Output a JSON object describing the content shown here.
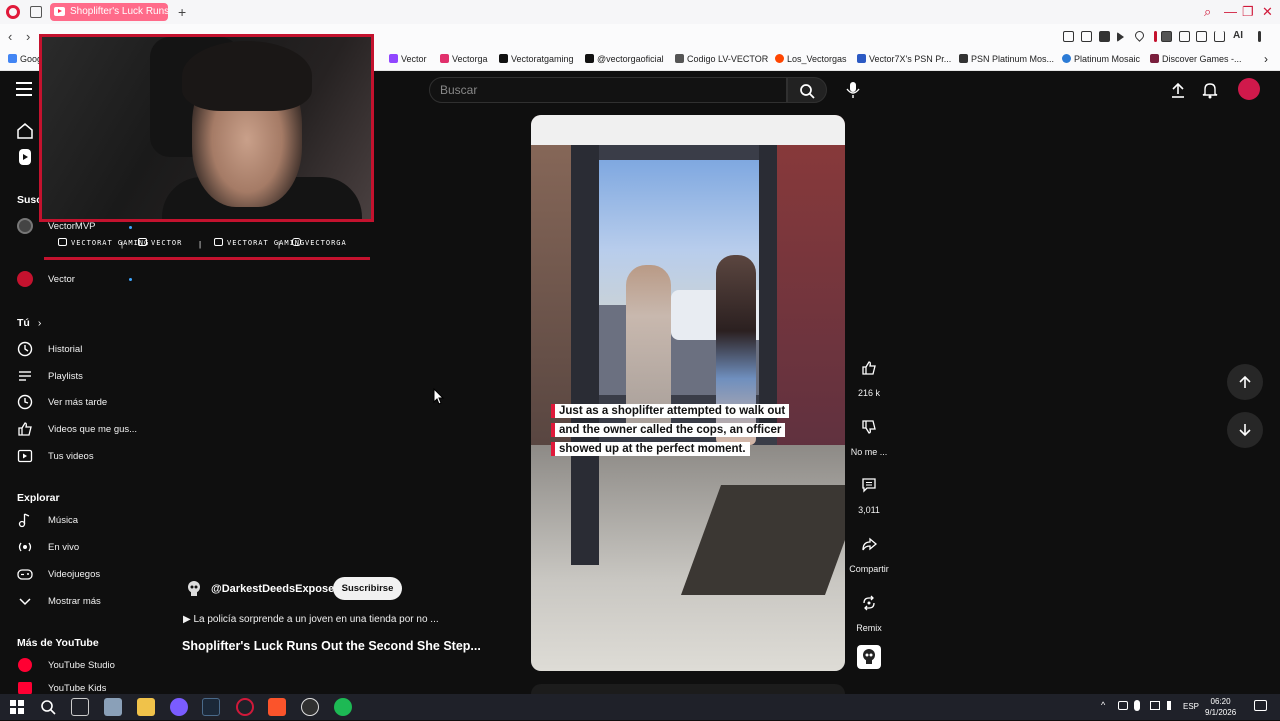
{
  "browser": {
    "active_tab_title": "Shoplifter's Luck Runs",
    "new_tab_symbol": "+",
    "back_symbol": "‹",
    "forward_symbol": "›",
    "bookmarks": [
      {
        "label": "Goog",
        "color": "#4285f4"
      },
      {
        "label": "Vector",
        "color": "#9146ff"
      },
      {
        "label": "Vectorga",
        "color": "#e1306c"
      },
      {
        "label": "Vectoratgaming",
        "color": "#111111"
      },
      {
        "label": "@vectorgaoficial",
        "color": "#111111"
      },
      {
        "label": "Codigo LV-VECTOR",
        "color": "#555555"
      },
      {
        "label": "Los_Vectorgas",
        "color": "#ff4500"
      },
      {
        "label": "Vector7X's PSN Pr...",
        "color": "#2b59c3"
      },
      {
        "label": "PSN Platinum Mos...",
        "color": "#333333"
      },
      {
        "label": "Platinum Mosaic",
        "color": "#2b7bd6"
      },
      {
        "label": "Discover Games -...",
        "color": "#7a1f3d"
      }
    ],
    "bookmarks_overflow": "›",
    "ext_label": "AI"
  },
  "header": {
    "search_placeholder": "Buscar"
  },
  "sidebar": {
    "subscriptions_title": "Susc",
    "subscriptions": [
      {
        "label": "VectorMVP",
        "color": "#444444"
      },
      {
        "label": "Vector",
        "color": "#c4122e"
      }
    ],
    "you_title": "Tú",
    "you_items": [
      {
        "label": "Historial",
        "icon": "history-icon"
      },
      {
        "label": "Playlists",
        "icon": "playlist-icon"
      },
      {
        "label": "Ver más tarde",
        "icon": "clock-icon"
      },
      {
        "label": "Videos que me gus...",
        "icon": "thumb-up-icon"
      },
      {
        "label": "Tus videos",
        "icon": "video-icon"
      }
    ],
    "explore_title": "Explorar",
    "explore_items": [
      {
        "label": "Música",
        "icon": "music-icon"
      },
      {
        "label": "En vivo",
        "icon": "live-icon"
      },
      {
        "label": "Videojuegos",
        "icon": "gamepad-icon"
      },
      {
        "label": "Mostrar más",
        "icon": "chevron-down-icon"
      }
    ],
    "more_title": "Más de YouTube",
    "more_items": [
      {
        "label": "YouTube Studio",
        "icon": "studio-icon"
      },
      {
        "label": "YouTube Kids",
        "icon": "kids-icon"
      }
    ]
  },
  "overlay": {
    "social": [
      {
        "label": "VECTORAT GAMING",
        "icon": "youtube-icon"
      },
      {
        "label": "VECTOR",
        "icon": "twitch-icon"
      },
      {
        "label": "VECTORAT GAMING",
        "icon": "twitter-icon"
      },
      {
        "label": "VECTORGA",
        "icon": "instagram-icon"
      }
    ],
    "separator": "|"
  },
  "short": {
    "caption_lines": [
      "Just as a shoplifter attempted to walk out",
      "and the owner called the cops, an officer",
      "showed up at the perfect moment."
    ],
    "channel": "@DarkestDeedsExposed",
    "subscribe_label": "Suscribirse",
    "playlist_text": "La policía sorprende a un joven en una tienda por no ...",
    "title": "Shoplifter's Luck Runs Out the Second She Step..."
  },
  "actions": {
    "likes": "216 k",
    "dislike_label": "No me ...",
    "comments": "3,011",
    "share_label": "Compartir",
    "remix_label": "Remix"
  },
  "taskbar": {
    "lang": "ESP",
    "time": "06:20",
    "date": "9/1/2026"
  },
  "colors": {
    "accent": "#c4122e",
    "youtube_red": "#ff0033",
    "link_blue": "#3ea6ff"
  }
}
